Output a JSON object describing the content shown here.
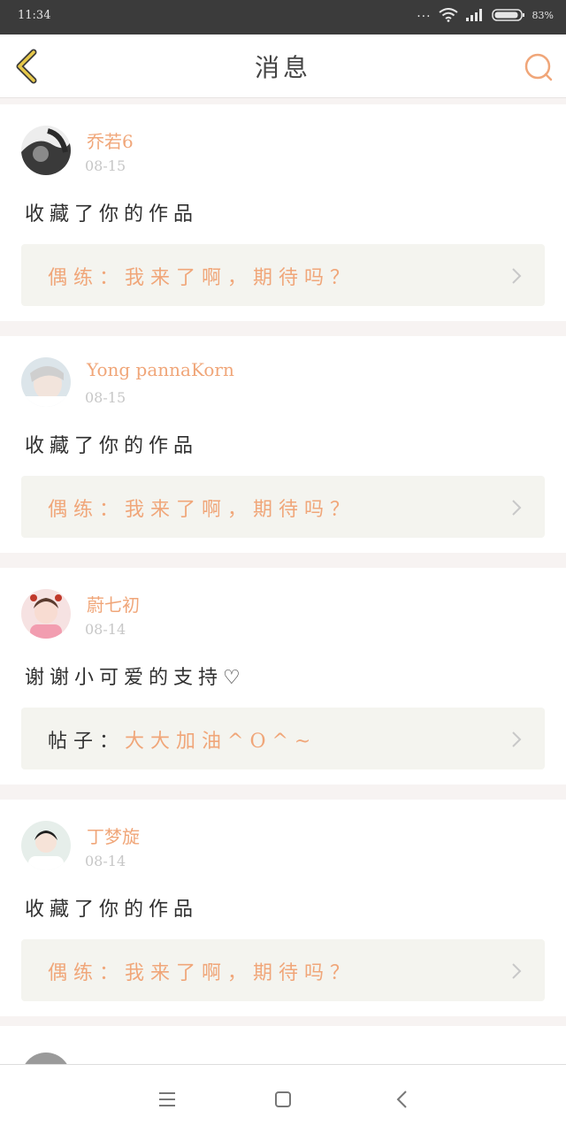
{
  "status_bar": {
    "time": "11:34",
    "dots": "...",
    "battery_pct": "83%"
  },
  "header": {
    "title": "消息"
  },
  "notifications": [
    {
      "username": "乔若6",
      "date": "08-15",
      "message": "收藏了你的作品",
      "ref_prefix": "偶练：",
      "ref_text": "我来了啊，期待吗？",
      "avatar_color": "#6b6b6b"
    },
    {
      "username": "Yong pannaKorn",
      "date": "08-15",
      "message": "收藏了你的作品",
      "ref_prefix": "偶练：",
      "ref_text": "我来了啊，期待吗？",
      "avatar_color": "#c9d5dc"
    },
    {
      "username": "蔚七初",
      "date": "08-14",
      "message": "谢谢小可爱的支持♡",
      "ref_prefix": "帖子：",
      "ref_text": "大大加油^O^~",
      "avatar_color": "#f1c4c8"
    },
    {
      "username": "丁梦旋",
      "date": "08-14",
      "message": "收藏了你的作品",
      "ref_prefix": "偶练：",
      "ref_text": "我来了啊，期待吗？",
      "avatar_color": "#dfe9e6"
    }
  ],
  "colors": {
    "accent": "#f0a679",
    "back_arrow": "#e6c84a",
    "ref_bg": "#f4f4ef"
  }
}
